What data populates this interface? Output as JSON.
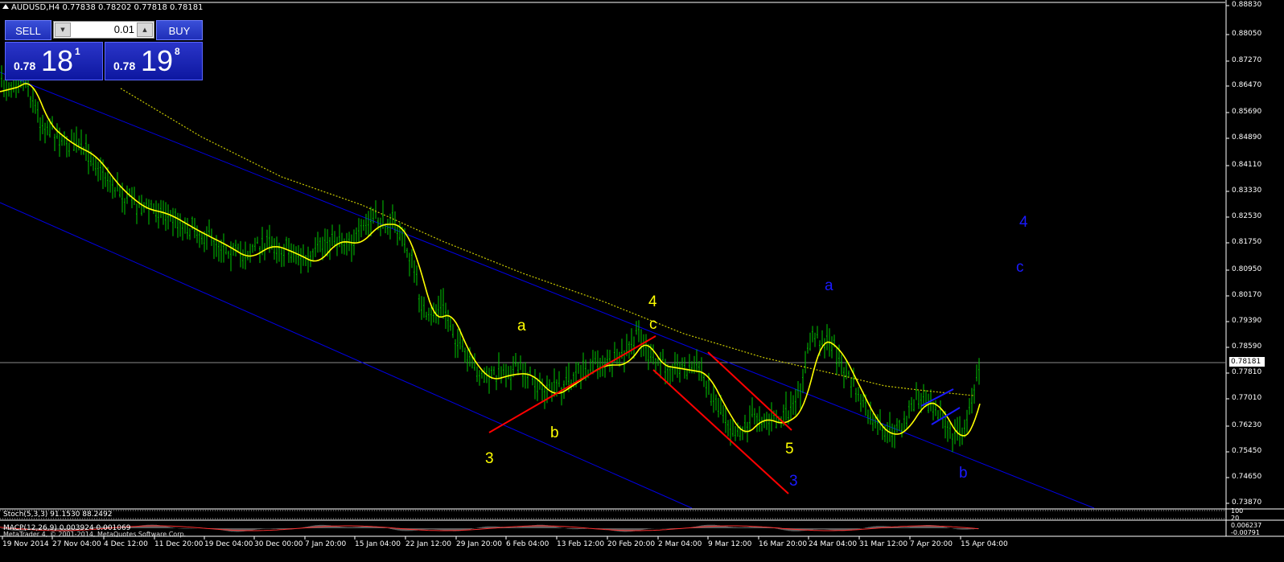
{
  "header": {
    "symbol_info": "AUDUSD,H4  0.77838 0.78202 0.77818 0.78181"
  },
  "trade_panel": {
    "sell_label": "SELL",
    "buy_label": "BUY",
    "lot_value": "0.01",
    "sell_price": {
      "big": "0.78",
      "main": "18",
      "pip": "1"
    },
    "buy_price": {
      "big": "0.78",
      "main": "19",
      "pip": "8"
    }
  },
  "price_axis": {
    "labels": [
      "0.88830",
      "0.88050",
      "0.87270",
      "0.86470",
      "0.85690",
      "0.84890",
      "0.84110",
      "0.83330",
      "0.82530",
      "0.81750",
      "0.80950",
      "0.80170",
      "0.79390",
      "0.78590",
      "0.78181",
      "0.77810",
      "0.77010",
      "0.76230",
      "0.75450",
      "0.74650",
      "0.73870"
    ],
    "current_price": "0.78181"
  },
  "time_axis": {
    "labels": [
      "19 Nov 2014",
      "27 Nov 04:00",
      "4 Dec 12:00",
      "11 Dec 20:00",
      "19 Dec 04:00",
      "30 Dec 00:00",
      "7 Jan 20:00",
      "15 Jan 04:00",
      "22 Jan 12:00",
      "29 Jan 20:00",
      "6 Feb 04:00",
      "13 Feb 12:00",
      "20 Feb 20:00",
      "2 Mar 04:00",
      "9 Mar 12:00",
      "16 Mar 20:00",
      "24 Mar 04:00",
      "31 Mar 12:00",
      "7 Apr 20:00",
      "15 Apr 04:00"
    ]
  },
  "wave_labels": [
    {
      "text": "3",
      "color": "#ffff00"
    },
    {
      "text": "a",
      "color": "#ffff00"
    },
    {
      "text": "b",
      "color": "#ffff00"
    },
    {
      "text": "4",
      "color": "#ffff00"
    },
    {
      "text": "c",
      "color": "#ffff00"
    },
    {
      "text": "5",
      "color": "#ffff00"
    },
    {
      "text": "3",
      "color": "#1a1aff"
    },
    {
      "text": "a",
      "color": "#1a1aff"
    },
    {
      "text": "b",
      "color": "#1a1aff"
    },
    {
      "text": "4",
      "color": "#1a1aff"
    },
    {
      "text": "c",
      "color": "#1a1aff"
    }
  ],
  "indicators": {
    "stoch": "Stoch(5,3,3) 91.1530 88.2492",
    "stoch_axis": [
      "100",
      "20"
    ],
    "macd": "MACP(12,26,9) 0.003924 0.001069",
    "macd_axis": [
      "0.006237",
      "-0.00791"
    ],
    "copyright": "MetaTrader 4, © 2001-2014, MetaQuotes Software Corp."
  },
  "colors": {
    "candles": "#00c800",
    "ma_fast": "#ffff00",
    "ma_slow": "#c8c800",
    "channel": "#0000e6",
    "wave_lines": "#ff0000",
    "wave_blue": "#1a1aff",
    "wave_yellow": "#ffff00"
  },
  "chart_data": {
    "type": "candlestick",
    "symbol": "AUDUSD",
    "timeframe": "H4",
    "ohlc_last": {
      "open": 0.77838,
      "high": 0.78202,
      "low": 0.77818,
      "close": 0.78181
    },
    "x": [
      "19 Nov 2014",
      "27 Nov",
      "4 Dec",
      "11 Dec",
      "19 Dec",
      "30 Dec",
      "7 Jan",
      "15 Jan",
      "22 Jan",
      "29 Jan",
      "6 Feb",
      "13 Feb",
      "20 Feb",
      "2 Mar",
      "9 Mar",
      "16 Mar",
      "24 Mar",
      "31 Mar",
      "7 Apr",
      "15 Apr"
    ],
    "close_approx": [
      0.866,
      0.858,
      0.843,
      0.828,
      0.816,
      0.817,
      0.812,
      0.822,
      0.802,
      0.778,
      0.774,
      0.781,
      0.781,
      0.77,
      0.765,
      0.768,
      0.788,
      0.762,
      0.766,
      0.782
    ],
    "ylim": [
      0.7387,
      0.8883
    ]
  }
}
